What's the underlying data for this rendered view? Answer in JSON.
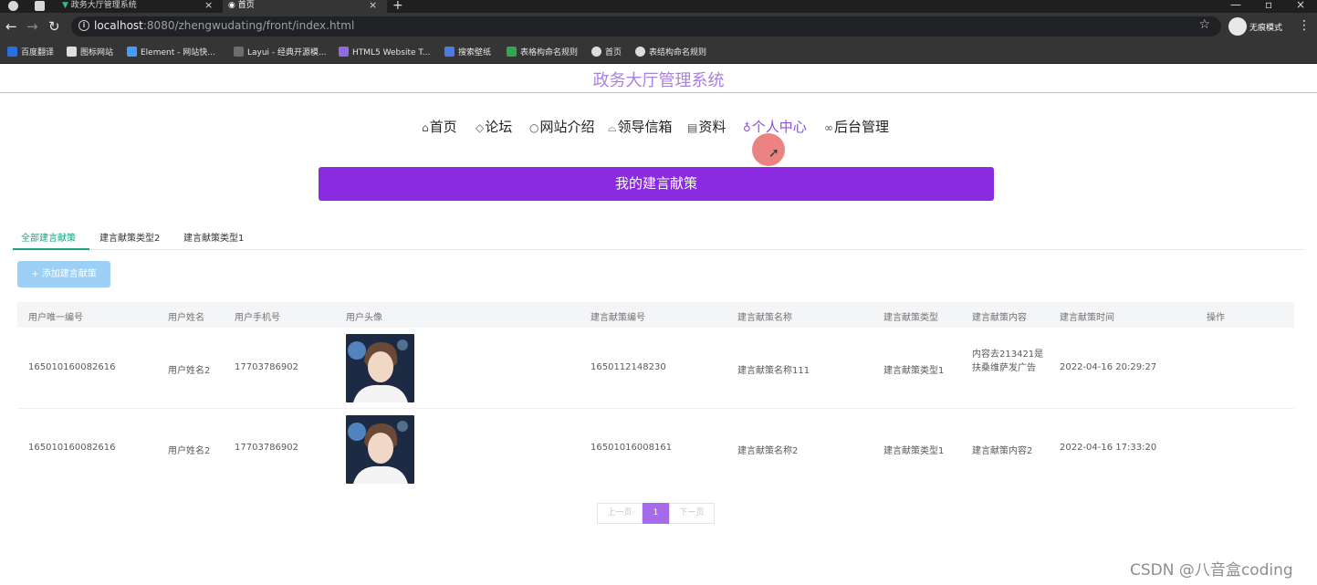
{
  "browser": {
    "tabs": [
      {
        "title": "政务大厅管理系统",
        "active": false
      },
      {
        "title": "首页",
        "active": true
      }
    ],
    "url_host": "localhost",
    "url_rest": ":8080/zhengwudating/front/index.html",
    "incognito_label": "无痕模式",
    "bookmarks": [
      "百度翻译",
      "图标网站",
      "Element - 网站快...",
      "Layui - 经典开源模...",
      "HTML5 Website T...",
      "搜索壁纸",
      "表格构命名规则",
      "首页",
      "表结构命名规则"
    ]
  },
  "site": {
    "title": "政务大厅管理系统"
  },
  "nav": {
    "items": [
      {
        "icon": "home-icon",
        "glyph": "⌂",
        "label": "首页"
      },
      {
        "icon": "forum-icon",
        "glyph": "◇",
        "label": "论坛"
      },
      {
        "icon": "info-icon",
        "glyph": "○",
        "label": "网站介绍"
      },
      {
        "icon": "mailbox-icon",
        "glyph": "⌓",
        "label": "领导信箱"
      },
      {
        "icon": "news-icon",
        "glyph": "▤",
        "label": "资料"
      },
      {
        "icon": "user-icon",
        "glyph": "♁",
        "label": "个人中心",
        "active": true
      },
      {
        "icon": "link-icon",
        "glyph": "∞",
        "label": "后台管理"
      }
    ]
  },
  "banner": {
    "text": "我的建言献策"
  },
  "tabs": [
    "全部建言献策",
    "建言献策类型2",
    "建言献策类型1"
  ],
  "add_button": "+ 添加建言献策",
  "table": {
    "headers": [
      "用户唯一编号",
      "用户姓名",
      "用户手机号",
      "用户头像",
      "建言献策编号",
      "建言献策名称",
      "建言献策类型",
      "建言献策内容",
      "建言献策时间",
      "操作"
    ],
    "rows": [
      {
        "uid": "165010160082616",
        "name": "用户姓名2",
        "phone": "17703786902",
        "sid": "1650112148230",
        "sname": "建言献策名称111",
        "stype": "建言献策类型1",
        "content": "内容去213421是扶桑维萨发广告",
        "time": "2022-04-16 20:29:27"
      },
      {
        "uid": "165010160082616",
        "name": "用户姓名2",
        "phone": "17703786902",
        "sid": "16501016008161",
        "sname": "建言献策名称2",
        "stype": "建言献策类型1",
        "content": "建言献策内容2",
        "time": "2022-04-16 17:33:20"
      }
    ]
  },
  "pagination": {
    "prev": "上一页",
    "current": "1",
    "next": "下一页"
  },
  "watermark": "CSDN @八音盒coding"
}
